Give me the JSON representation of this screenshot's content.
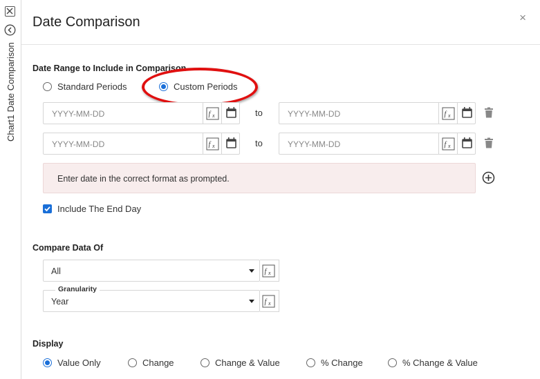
{
  "side_panel": {
    "vertical_title": "Chart1 Date Comparison",
    "close_icon": "close-box-icon",
    "back_icon": "back-circle-icon"
  },
  "dialog": {
    "title": "Date Comparison",
    "close_symbol": "×"
  },
  "date_range": {
    "label": "Date Range to Include in Comparison",
    "options": [
      {
        "label": "Standard Periods",
        "selected": false
      },
      {
        "label": "Custom Periods",
        "selected": true
      }
    ],
    "rows": [
      {
        "from_placeholder": "YYYY-MM-DD",
        "to_label": "to",
        "to_placeholder": "YYYY-MM-DD"
      },
      {
        "from_placeholder": "YYYY-MM-DD",
        "to_label": "to",
        "to_placeholder": "YYYY-MM-DD"
      }
    ],
    "error_message": "Enter date in the correct format as prompted.",
    "include_end_day": {
      "label": "Include The End Day",
      "checked": true
    }
  },
  "compare": {
    "label": "Compare Data Of",
    "data_select": {
      "value": "All"
    },
    "granularity": {
      "label": "Granularity",
      "value": "Year"
    }
  },
  "display": {
    "label": "Display",
    "options": [
      {
        "label": "Value Only",
        "selected": true
      },
      {
        "label": "Change",
        "selected": false
      },
      {
        "label": "Change & Value",
        "selected": false
      },
      {
        "label": "% Change",
        "selected": false
      },
      {
        "label": "% Change & Value",
        "selected": false
      }
    ]
  },
  "colors": {
    "accent": "#1a6fd8",
    "highlight": "#e01010",
    "error_bg": "#f8eded"
  }
}
